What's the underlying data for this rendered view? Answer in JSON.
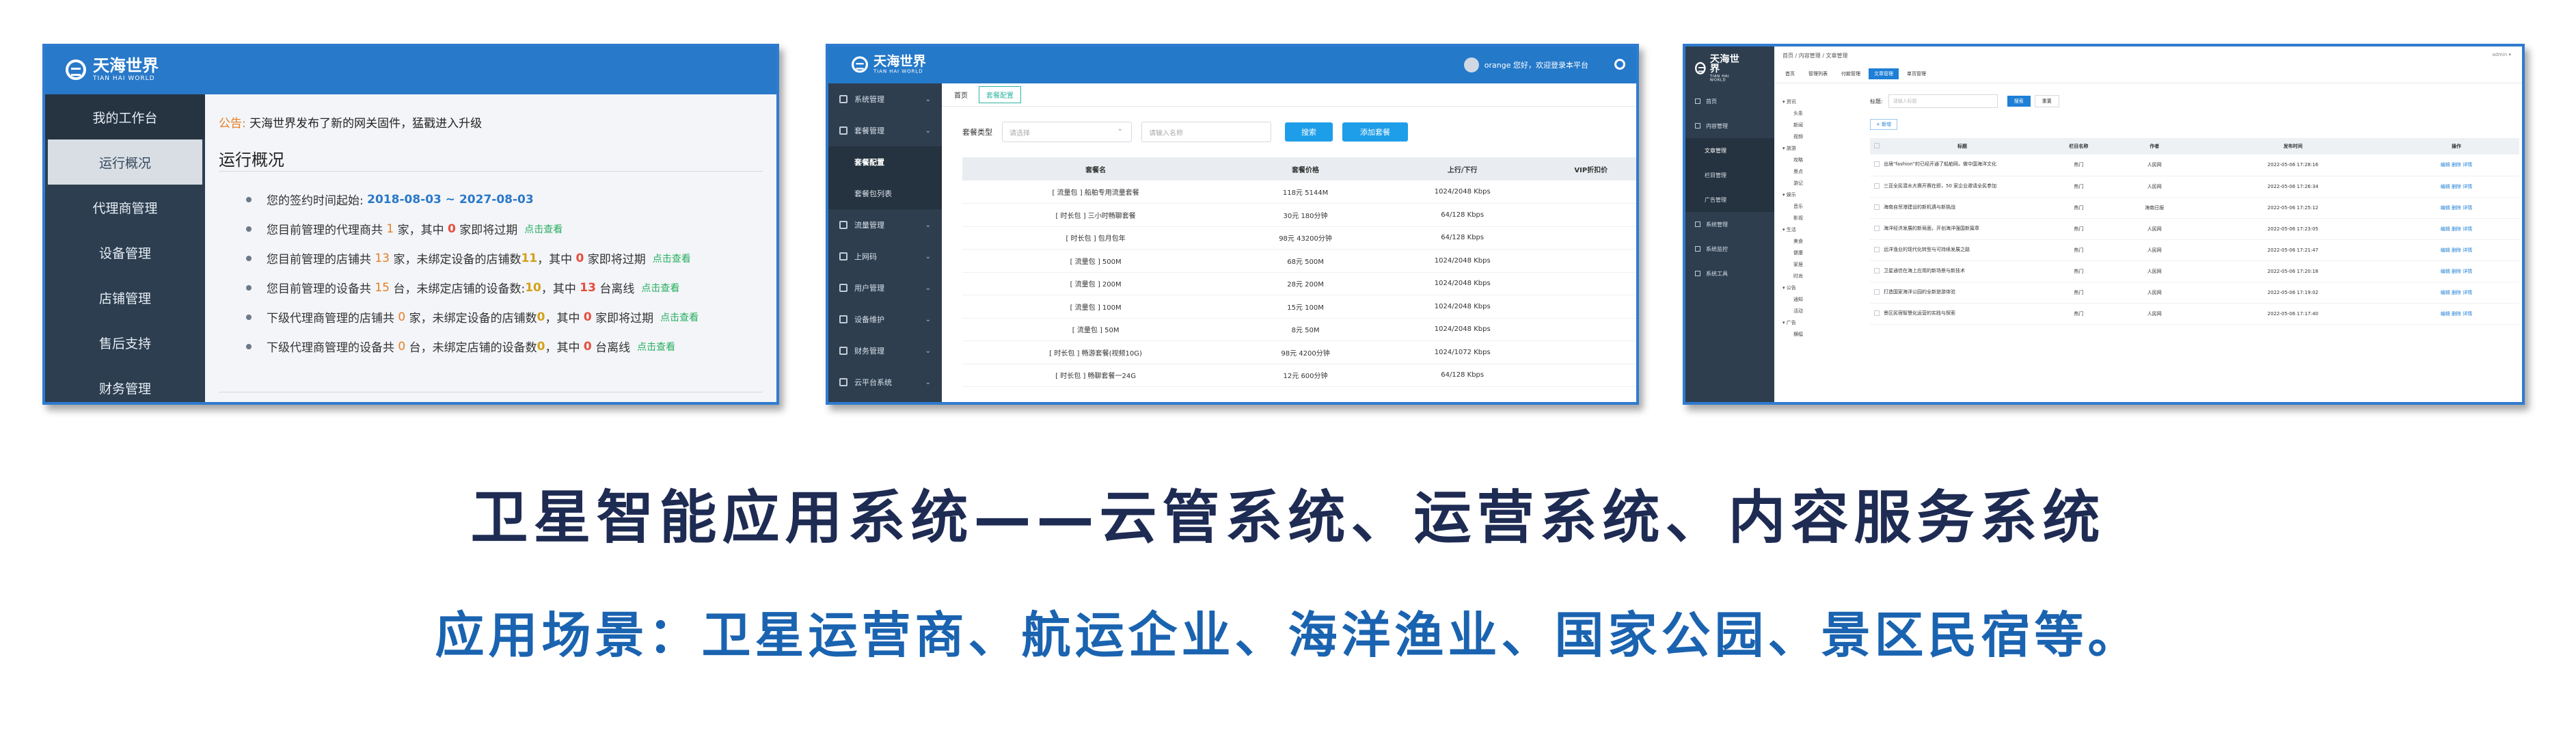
{
  "panel1": {
    "logo": {
      "name": "天海世界",
      "sub": "TIAN HAI WORLD"
    },
    "sidebar": [
      "我的工作台",
      "运行概况",
      "代理商管理",
      "设备管理",
      "店铺管理",
      "售后支持",
      "财务管理"
    ],
    "notice_label": "公告:",
    "notice_text": "天海世界发布了新的网关固件，猛戳进入升级",
    "section_title": "运行概况",
    "contract_label": "您的签约时间起始:",
    "contract_range": "2018-08-03 ~ 2027-08-03",
    "line2": {
      "a": "您目前管理的代理商共",
      "n1": "1",
      "b": "家，其中",
      "n2": "0",
      "c": "家即将过期",
      "link": "点击查看"
    },
    "line3": {
      "a": "您目前管理的店铺共",
      "n1": "13",
      "b": "家，未绑定设备的店铺数",
      "n2": "11",
      "c": "，其中",
      "n3": "0",
      "d": "家即将过期",
      "link": "点击查看"
    },
    "line4": {
      "a": "您目前管理的设备共",
      "n1": "15",
      "b": "台，未绑定店铺的设备数:",
      "n2": "10",
      "c": "，其中",
      "n3": "13",
      "d": "台离线",
      "link": "点击查看"
    },
    "line5": {
      "a": "下级代理商管理的店铺共",
      "n1": "0",
      "b": "家，未绑定设备的店铺数",
      "n2": "0",
      "c": "，其中",
      "n3": "0",
      "d": "家即将过期",
      "link": "点击查看"
    },
    "line6": {
      "a": "下级代理商管理的设备共",
      "n1": "0",
      "b": "台，未绑定店铺的设备数",
      "n2": "0",
      "c": "，其中",
      "n3": "0",
      "d": "台离线",
      "link": "点击查看"
    }
  },
  "panel2": {
    "logo": {
      "name": "天海世界",
      "sub": "TIAN HAI WORLD"
    },
    "user_name": "orange 您好，欢迎登录本平台",
    "sidebar": [
      {
        "label": "系统管理",
        "sub": false
      },
      {
        "label": "套餐管理",
        "sub": false
      },
      {
        "label": "套餐配置",
        "sub": true,
        "active": true
      },
      {
        "label": "套餐包列表",
        "sub": true
      },
      {
        "label": "流量管理",
        "sub": false
      },
      {
        "label": "上网码",
        "sub": false
      },
      {
        "label": "用户管理",
        "sub": false
      },
      {
        "label": "设备维护",
        "sub": false
      },
      {
        "label": "财务管理",
        "sub": false
      },
      {
        "label": "云平台系统",
        "sub": false
      }
    ],
    "tabs": [
      "首页",
      "套餐配置"
    ],
    "filter_label": "套餐类型",
    "filter_select": "请选择",
    "filter_input": "请输入名称",
    "search_btn": "搜索",
    "add_btn": "添加套餐",
    "columns": [
      "套餐名",
      "套餐价格",
      "上行/下行",
      "VIP折扣价"
    ],
    "rows": [
      [
        "[ 流量包 ] 船舶专用流量套餐",
        "118元 5144M",
        "1024/2048 Kbps",
        ""
      ],
      [
        "[ 时长包 ] 三小时畅聊套餐",
        "30元 180分钟",
        "64/128 Kbps",
        ""
      ],
      [
        "[ 时长包 ] 包月包年",
        "98元 43200分钟",
        "64/128 Kbps",
        ""
      ],
      [
        "[ 流量包 ] 500M",
        "68元 500M",
        "1024/2048 Kbps",
        ""
      ],
      [
        "[ 流量包 ] 200M",
        "28元 200M",
        "1024/2048 Kbps",
        ""
      ],
      [
        "[ 流量包 ] 100M",
        "15元 100M",
        "1024/2048 Kbps",
        ""
      ],
      [
        "[ 流量包 ] 50M",
        "8元 50M",
        "1024/2048 Kbps",
        ""
      ],
      [
        "[ 时长包 ] 畅游套餐(视频10G)",
        "98元 4200分钟",
        "1024/1072 Kbps",
        ""
      ],
      [
        "[ 时长包 ] 畅聊套餐一24G",
        "12元 600分钟",
        "64/128 Kbps",
        ""
      ]
    ]
  },
  "panel3": {
    "logo": {
      "name": "天海世界",
      "sub": "TIAN HAI WORLD"
    },
    "breadcrumb": "首页 / 内容管理 / 文章管理",
    "greeting": "admin ▾",
    "sidebar": [
      {
        "label": "首页",
        "sub": false
      },
      {
        "label": "内容管理",
        "sub": false
      },
      {
        "label": "文章管理",
        "sub": true,
        "active": true
      },
      {
        "label": "栏目管理",
        "sub": true
      },
      {
        "label": "广告管理",
        "sub": true
      },
      {
        "label": "系统管理",
        "sub": false
      },
      {
        "label": "系统监控",
        "sub": false
      },
      {
        "label": "系统工具",
        "sub": false
      }
    ],
    "tabs": [
      "首页",
      "管理列表",
      "付款管理",
      "文章管理",
      "单页管理"
    ],
    "tree": [
      {
        "t": "▾ 资讯",
        "c": false
      },
      {
        "t": "头条",
        "c": true
      },
      {
        "t": "新闻",
        "c": true
      },
      {
        "t": "视频",
        "c": true
      },
      {
        "t": "▾ 旅游",
        "c": false
      },
      {
        "t": "攻略",
        "c": true
      },
      {
        "t": "景点",
        "c": true
      },
      {
        "t": "游记",
        "c": true
      },
      {
        "t": "▾ 娱乐",
        "c": false
      },
      {
        "t": "音乐",
        "c": true
      },
      {
        "t": "影视",
        "c": true
      },
      {
        "t": "▾ 生活",
        "c": false
      },
      {
        "t": "美食",
        "c": true
      },
      {
        "t": "健康",
        "c": true
      },
      {
        "t": "家居",
        "c": true
      },
      {
        "t": "时尚",
        "c": true
      },
      {
        "t": "▾ 公告",
        "c": false
      },
      {
        "t": "通知",
        "c": true
      },
      {
        "t": "活动",
        "c": true
      },
      {
        "t": "▾ 广告",
        "c": false
      },
      {
        "t": "横幅",
        "c": true
      }
    ],
    "search_label": "标题:",
    "search_placeholder": "请输入标题",
    "search_btn": "搜索",
    "reset_btn": "重置",
    "add_btn": "+ 新增",
    "columns": [
      "",
      "标题",
      "栏目名称",
      "作者",
      "发布时间",
      "操作"
    ],
    "rows": [
      [
        "出境\"fashion\"的已经开通了船舶网，做中国海洋文化",
        "热门",
        "人民网",
        "2022-05-06 17:28:16"
      ],
      [
        "三亚全民潜水大赛开赛在即，50 家企业邀请全民参加",
        "热门",
        "人民网",
        "2022-05-06 17:26:34"
      ],
      [
        "海南自贸港建设的新机遇与新挑战",
        "热门",
        "海南日报",
        "2022-05-06 17:25:12"
      ],
      [
        "海洋经济发展的新局面，开创海洋强国新篇章",
        "热门",
        "人民网",
        "2022-05-06 17:23:05"
      ],
      [
        "远洋渔业的现代化转型与可持续发展之路",
        "热门",
        "人民网",
        "2022-05-06 17:21:47"
      ],
      [
        "卫星通信在海上应用的新场景与新技术",
        "热门",
        "人民网",
        "2022-05-06 17:20:18"
      ],
      [
        "打造国家海洋公园的全新旅游体验",
        "热门",
        "人民网",
        "2022-05-06 17:19:02"
      ],
      [
        "景区民宿智慧化运营的实践与探索",
        "热门",
        "人民网",
        "2022-05-06 17:17:40"
      ]
    ],
    "row_actions": [
      "编辑",
      "删除",
      "详情"
    ]
  },
  "title": "卫星智能应用系统——云管系统、运营系统、内容服务系统",
  "subtitle": "应用场景：卫星运营商、航运企业、海洋渔业、国家公园、景区民宿等。"
}
